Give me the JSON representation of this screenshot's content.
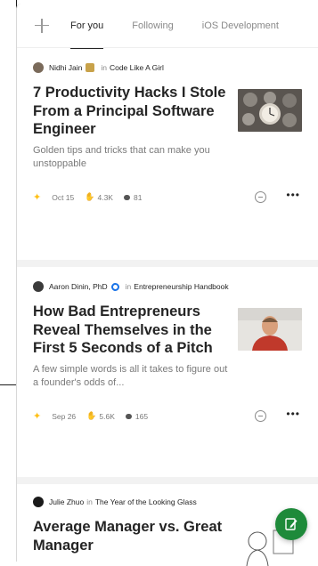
{
  "tabs": [
    {
      "label": "For you",
      "active": true
    },
    {
      "label": "Following",
      "active": false
    },
    {
      "label": "iOS Development",
      "active": false
    }
  ],
  "articles": [
    {
      "author": "Nidhi Jain",
      "in_word": "in",
      "publication": "Code Like A Girl",
      "title": "7 Productivity Hacks I Stole From a Principal Software Engineer",
      "subtitle": "Golden tips and tricks that can make you unstoppable",
      "date": "Oct 15",
      "claps": "4.3K",
      "comments": "81",
      "thumbnail_icon": "watch-collage-image"
    },
    {
      "author": "Aaron Dinin, PhD",
      "in_word": "in",
      "publication": "Entrepreneurship Handbook",
      "title": "How Bad Entrepreneurs Reveal Themselves in the First 5 Seconds of a Pitch",
      "subtitle": "A few simple words is all it takes to figure out a founder's odds of...",
      "date": "Sep 26",
      "claps": "5.6K",
      "comments": "165",
      "thumbnail_icon": "man-portrait-image"
    },
    {
      "author": "Julie Zhuo",
      "in_word": "in",
      "publication": "The Year of the Looking Glass",
      "title": "Average Manager vs. Great Manager",
      "thumbnail_icon": "sketch-drawing-image"
    }
  ],
  "icons": {
    "add": "plus-icon",
    "member": "star-icon",
    "claps": "clap-icon",
    "comments": "comment-icon",
    "show_less": "minus-circle-icon",
    "more": "more-icon",
    "write": "pencil-icon"
  },
  "colors": {
    "accent_green": "#1e8a3a",
    "member_star": "#ffc017",
    "verified_blue": "#1a73e8"
  }
}
